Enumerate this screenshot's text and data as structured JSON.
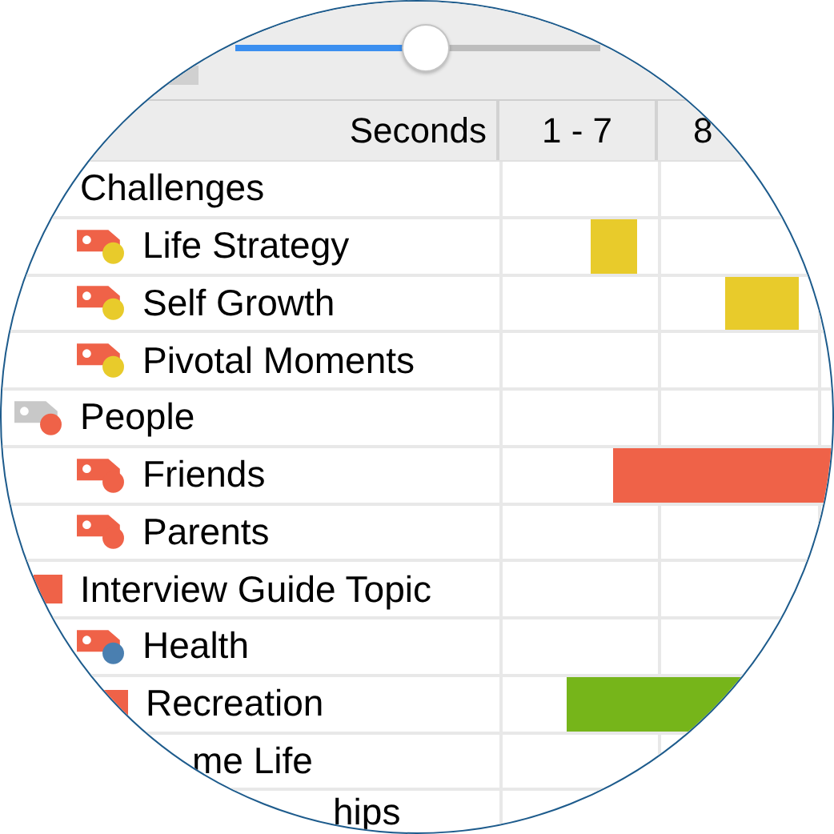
{
  "slider": {
    "level": 0.52
  },
  "table": {
    "columns": [
      {
        "label": "Seconds"
      },
      {
        "label": "1 - 7"
      },
      {
        "label": "8"
      }
    ],
    "rows": [
      {
        "label": "Challenges",
        "kind": "plain",
        "children": [
          {
            "label": "Life Strategy",
            "kind": "tag",
            "color": "#ef6248",
            "badge": {
              "color": "#e8cb2b"
            },
            "bar": {
              "color": "#e8cb2b"
            }
          },
          {
            "label": "Self Growth",
            "kind": "tag",
            "color": "#ef6248",
            "badge": {
              "color": "#e8cb2b"
            },
            "bar": {
              "color": "#e8cb2b"
            }
          },
          {
            "label": "Pivotal Moments",
            "kind": "tag",
            "color": "#ef6248",
            "badge": {
              "color": "#e8cb2b"
            }
          }
        ]
      },
      {
        "label": "People",
        "kind": "tag",
        "color": "#c8c8c8",
        "badge": {
          "color": "#ef6248"
        },
        "children": [
          {
            "label": "Friends",
            "kind": "tag",
            "color": "#ef6248",
            "badge": {
              "color": "#ef6248"
            },
            "bar": {
              "color": "#ef6248"
            }
          },
          {
            "label": "Parents",
            "kind": "tag",
            "color": "#ef6248",
            "badge": {
              "color": "#ef6248"
            }
          }
        ]
      },
      {
        "label": "Interview Guide Topic",
        "kind": "square",
        "color": "#ef6248",
        "children": [
          {
            "label": "Health",
            "kind": "tag",
            "color": "#ef6248",
            "badge": {
              "color": "#4a7fb0"
            }
          },
          {
            "label": "Recreation",
            "kind": "square",
            "color": "#ef6248",
            "bar": {
              "color": "#76b51a"
            }
          },
          {
            "label": "me Life",
            "kind": "partial"
          },
          {
            "label": "hips",
            "kind": "partial"
          }
        ]
      }
    ]
  }
}
